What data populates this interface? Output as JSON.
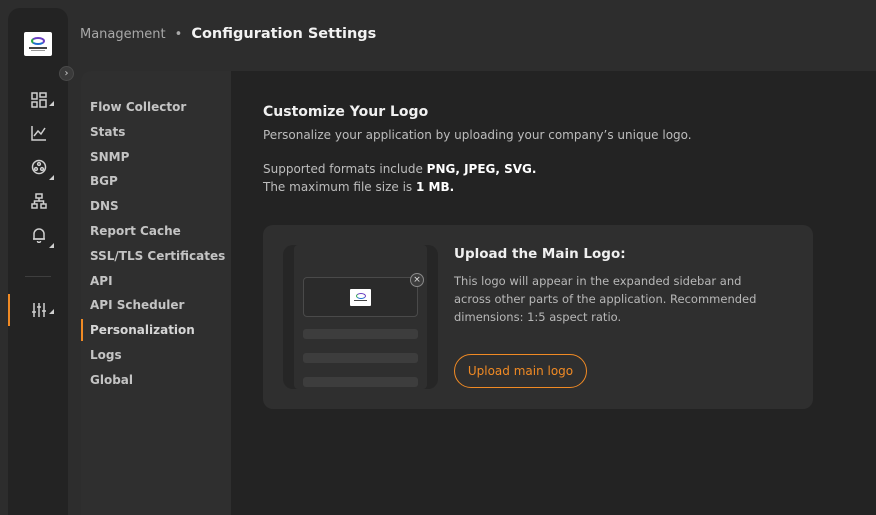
{
  "breadcrumb": {
    "parent": "Management",
    "separator": "•",
    "current": "Configuration Settings"
  },
  "rail": {
    "collapse_icon": "chevron-right-icon",
    "icons": [
      "dashboard-icon",
      "chart-icon",
      "network-icon",
      "topology-icon",
      "bell-icon",
      "sliders-icon"
    ],
    "active": "sliders-icon"
  },
  "subnav": {
    "items": [
      {
        "label": "Flow Collector"
      },
      {
        "label": "Stats"
      },
      {
        "label": "SNMP"
      },
      {
        "label": "BGP"
      },
      {
        "label": "DNS"
      },
      {
        "label": "Report Cache"
      },
      {
        "label": "SSL/TLS Certificates"
      },
      {
        "label": "API"
      },
      {
        "label": "API Scheduler"
      },
      {
        "label": "Personalization"
      },
      {
        "label": "Logs"
      },
      {
        "label": "Global"
      }
    ],
    "active": "Personalization"
  },
  "main": {
    "title": "Customize Your Logo",
    "description": "Personalize your application by uploading your company’s unique logo.",
    "formats_prefix": "Supported formats include ",
    "formats_value": "PNG, JPEG, SVG.",
    "size_prefix": "The maximum file size is ",
    "size_value": "1 MB.",
    "card": {
      "title": "Upload the Main Logo:",
      "description": "This logo will appear in the expanded sidebar and across other parts of the application. Recommended dimensions: 1:5 aspect ratio.",
      "button_label": "Upload main logo",
      "remove_symbol": "×"
    }
  },
  "colors": {
    "accent": "#f08a24",
    "background": "#2d2d2d",
    "panel": "#232323"
  }
}
